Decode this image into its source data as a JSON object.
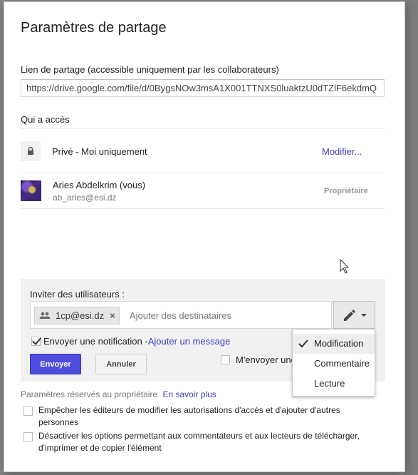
{
  "dialog": {
    "title": "Paramètres de partage"
  },
  "share_link": {
    "label": "Lien de partage (accessible uniquement par les collaborateurs)",
    "value": "https://drive.google.com/file/d/0BygsNOw3msA1X001TTNXS0luaktzU0dTZlF6ekdmQ"
  },
  "access": {
    "label": "Qui a accès",
    "visibility": {
      "icon": "lock-icon",
      "text": "Privé - Moi uniquement",
      "modify_link": "Modifier..."
    },
    "people": [
      {
        "name": "Aries Abdelkrim (vous)",
        "email": "ab_aries@esi.dz",
        "role": "Propriétaire"
      }
    ]
  },
  "invite": {
    "label": "Inviter des utilisateurs :",
    "chips": [
      {
        "icon": "people-icon",
        "text": "1cp@esi.dz"
      }
    ],
    "placeholder": "Ajouter des destinataires",
    "permission_icon": "pencil-icon",
    "notify_checked": true,
    "notify_text": "Envoyer une notification - ",
    "add_message_link": "Ajouter un message",
    "send_label": "Envoyer",
    "cancel_label": "Annuler",
    "copy_self_checked": false,
    "copy_self_text": "M'envoyer une"
  },
  "permission_menu": {
    "items": [
      {
        "label": "Modification",
        "selected": true
      },
      {
        "label": "Commentaire",
        "selected": false
      },
      {
        "label": "Lecture",
        "selected": false
      }
    ]
  },
  "owner_settings": {
    "label": "Paramètres réservés au propriétaire",
    "learn_more": "En savoir plus",
    "options": [
      {
        "checked": false,
        "text": "Empêcher les éditeurs de modifier les autorisations d'accès et d'ajouter d'autres personnes"
      },
      {
        "checked": false,
        "text": "Désactiver les options permettant aux commentateurs et aux lecteurs de télécharger, d'imprimer et de copier l'élément"
      }
    ]
  },
  "colors": {
    "accent": "#4d4ee0",
    "link": "#3f3fbf",
    "overlay": "#8a8a8a"
  }
}
